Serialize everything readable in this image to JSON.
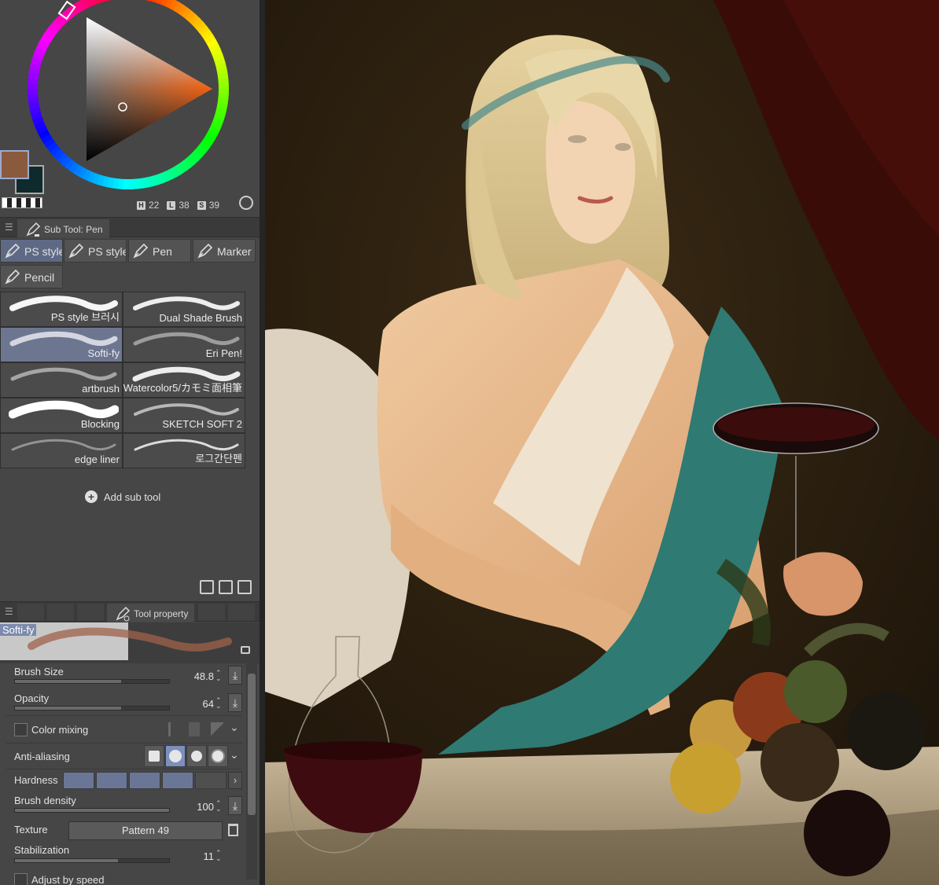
{
  "color_wheel": {
    "hue_key": "H",
    "hue": "22",
    "lum_key": "L",
    "lum": "38",
    "sat_key": "S",
    "sat": "39",
    "main_color": "#8a5a3e",
    "sub_color": "#0f2a2c"
  },
  "subtool": {
    "header": "Sub Tool: Pen",
    "groups": [
      "PS style",
      "PS style",
      "Pen",
      "Marker",
      "Pencil"
    ],
    "brushes": [
      "PS style 브러시",
      "Dual Shade Brush",
      "Softi-fy",
      "Eri Pen!",
      "artbrush",
      "Watercolor5/カモミ面相筆",
      "Blocking",
      "SKETCH SOFT 2",
      "edge liner",
      "로그간단펜"
    ],
    "active_brush": "Softi-fy",
    "add_label": "Add sub tool"
  },
  "tool_property": {
    "header": "Tool property",
    "preview_name": "Softi-fy",
    "brush_size_label": "Brush Size",
    "brush_size": "48.8",
    "brush_size_fill": 0.69,
    "opacity_label": "Opacity",
    "opacity": "64",
    "opacity_fill": 0.69,
    "color_mixing_label": "Color mixing",
    "anti_aliasing_label": "Anti-aliasing",
    "hardness_label": "Hardness",
    "brush_density_label": "Brush density",
    "brush_density": "100",
    "brush_density_fill": 1.0,
    "texture_label": "Texture",
    "texture_value": "Pattern 49",
    "stabilization_label": "Stabilization",
    "stabilization": "11",
    "stabilization_fill": 0.67,
    "adjust_label": "Adjust by speed"
  }
}
